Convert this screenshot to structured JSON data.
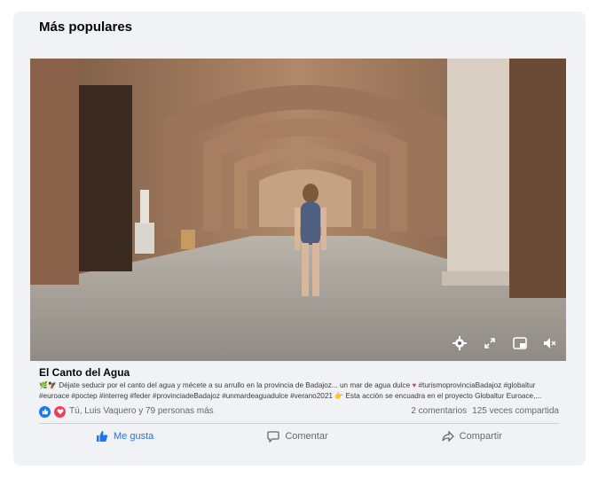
{
  "section": {
    "title": "Más populares"
  },
  "video": {
    "controls": [
      {
        "icon": "gear-icon"
      },
      {
        "icon": "fullscreen-icon"
      },
      {
        "icon": "picture-in-picture-icon"
      },
      {
        "icon": "muted-speaker-icon"
      }
    ]
  },
  "post": {
    "title": "El Canto del Agua",
    "description_line1": "Déjate seducir por el canto del agua y mécete a su arrullo en la provincia de Badajoz... un mar de agua dulce",
    "description_line1b": "#turismoprovinciaBadajoz #globaltur",
    "description_line2": "#euroace #poctep #interreg #feder #provinciadeBadajoz #unmardeaguadulce #verano2021",
    "description_line2b": "Esta acción se encuadra en el proyecto Globaltur Euroace,..."
  },
  "stats": {
    "reactors": "Tú, Luis Vaquero y 79 personas más",
    "comments": "2 comentarios",
    "shares": "125 veces compartida"
  },
  "actions": {
    "like": "Me gusta",
    "comment": "Comentar",
    "share": "Compartir"
  },
  "colors": {
    "accent": "#1877f2",
    "love": "#f33e58",
    "card_bg": "#f0f2f5"
  }
}
